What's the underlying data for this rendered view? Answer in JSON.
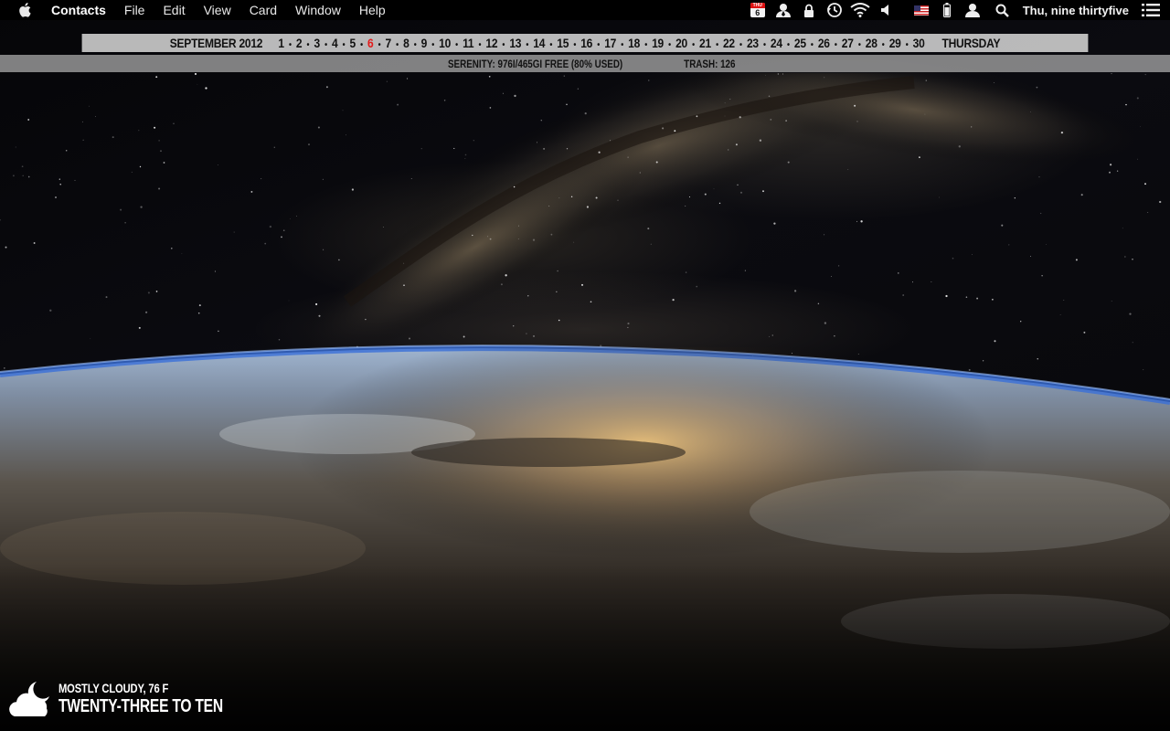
{
  "menubar": {
    "app_name": "Contacts",
    "menus": [
      "File",
      "Edit",
      "View",
      "Card",
      "Window",
      "Help"
    ],
    "status_icons": [
      {
        "name": "calendar-icon",
        "weekday": "THU",
        "day": "6"
      },
      {
        "name": "contacts-person-icon"
      },
      {
        "name": "lock-icon"
      },
      {
        "name": "time-machine-icon"
      },
      {
        "name": "wifi-icon"
      },
      {
        "name": "volume-icon"
      },
      {
        "name": "us-flag-input-icon"
      },
      {
        "name": "battery-icon"
      },
      {
        "name": "user-icon"
      },
      {
        "name": "spotlight-search-icon"
      }
    ],
    "clock": "Thu, nine thirtyfive",
    "notification_icon": "list-icon"
  },
  "calendar_strip": {
    "month_year": "SEPTEMBER  2012",
    "days": [
      "1",
      "2",
      "3",
      "4",
      "5",
      "6",
      "7",
      "8",
      "9",
      "10",
      "11",
      "12",
      "13",
      "14",
      "15",
      "16",
      "17",
      "18",
      "19",
      "20",
      "21",
      "22",
      "23",
      "24",
      "25",
      "26",
      "27",
      "28",
      "29",
      "30"
    ],
    "today": "6",
    "weekday": "THURSDAY",
    "today_color": "#e21b1b"
  },
  "disk_strip": {
    "disk": "SERENITY: 976I/465GI FREE (80% USED)",
    "trash": "TRASH: 126"
  },
  "weather": {
    "condition": "MOSTLY CLOUDY, 76 F",
    "time_words": "TWENTY-THREE TO TEN",
    "icon": "cloud-moon-icon"
  }
}
